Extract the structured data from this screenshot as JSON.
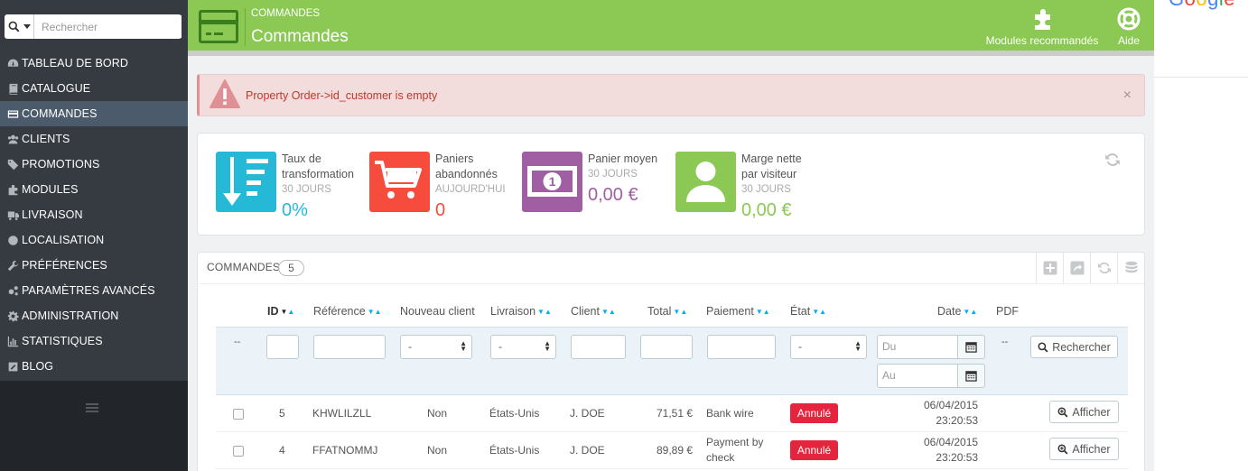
{
  "search": {
    "placeholder": "Rechercher"
  },
  "sidebar": {
    "items": [
      {
        "label": "TABLEAU DE BORD",
        "icon": "dashboard-icon"
      },
      {
        "label": "CATALOGUE",
        "icon": "book-icon"
      },
      {
        "label": "COMMANDES",
        "icon": "credit-card-icon",
        "active": true
      },
      {
        "label": "CLIENTS",
        "icon": "users-icon"
      },
      {
        "label": "PROMOTIONS",
        "icon": "tags-icon"
      },
      {
        "label": "MODULES",
        "icon": "puzzle-icon"
      },
      {
        "label": "LIVRAISON",
        "icon": "truck-icon"
      },
      {
        "label": "LOCALISATION",
        "icon": "globe-icon"
      },
      {
        "label": "PRÉFÉRENCES",
        "icon": "wrench-icon"
      },
      {
        "label": "PARAMÈTRES AVANCÉS",
        "icon": "cogs-icon"
      },
      {
        "label": "ADMINISTRATION",
        "icon": "cog-icon"
      },
      {
        "label": "STATISTIQUES",
        "icon": "bar-chart-icon"
      },
      {
        "label": "BLOG",
        "icon": "edit-icon"
      }
    ]
  },
  "header": {
    "breadcrumb": "COMMANDES",
    "title": "Commandes",
    "tools": {
      "modules": "Modules recommandés",
      "aide": "Aide"
    },
    "color": "#8bc954"
  },
  "alert": {
    "text": "Property Order->id_customer is empty",
    "close": "×"
  },
  "kpis": [
    {
      "line1": "Taux de",
      "line2": "transformation",
      "period": "30 JOURS",
      "value": "0%",
      "color": "#25b9d7"
    },
    {
      "line1": "Paniers",
      "line2": "abandonnés",
      "period": "AUJOURD'HUI",
      "value": "0",
      "color": "#f54c3e"
    },
    {
      "line1": "Panier moyen",
      "line2": "",
      "period": "30 JOURS",
      "value": "0,00 €",
      "color": "#a05fa3"
    },
    {
      "line1": "Marge nette",
      "line2": "par visiteur",
      "period": "30 JOURS",
      "value": "0,00 €",
      "color": "#8bc954"
    }
  ],
  "orders": {
    "title": "COMMANDES",
    "count": "5",
    "columns": {
      "id": "ID",
      "reference": "Référence",
      "new_client": "Nouveau client",
      "delivery": "Livraison",
      "client": "Client",
      "total": "Total",
      "payment": "Paiement",
      "state": "État",
      "date": "Date",
      "pdf": "PDF"
    },
    "filters": {
      "dash": "--",
      "select_default": "-",
      "date_from": "Du",
      "date_to": "Au",
      "pdf_dash": "--",
      "search_button": "Rechercher"
    },
    "rows": [
      {
        "id": "5",
        "reference": "KHWLILZLL",
        "new_client": "Non",
        "delivery": "États-Unis",
        "client": "J. DOE",
        "total": "71,51 €",
        "payment1": "Bank wire",
        "payment2": "",
        "state": "Annulé",
        "date": "06/04/2015",
        "time": "23:20:53",
        "action": "Afficher"
      },
      {
        "id": "4",
        "reference": "FFATNOMMJ",
        "new_client": "Non",
        "delivery": "États-Unis",
        "client": "J. DOE",
        "total": "89,89 €",
        "payment1": "Payment by",
        "payment2": "check",
        "state": "Annulé",
        "date": "06/04/2015",
        "time": "23:20:53",
        "action": "Afficher"
      }
    ]
  }
}
